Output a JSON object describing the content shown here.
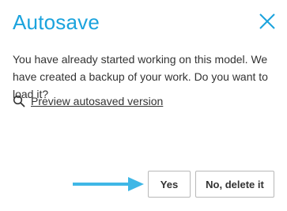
{
  "dialog": {
    "title": "Autosave",
    "message": "You have already started working on this model. We have created a backup of your work. Do you want to load it?",
    "preview_link": "Preview autosaved version",
    "yes_label": "Yes",
    "no_label": "No, delete it"
  },
  "icons": {
    "close": "close-icon",
    "search": "search-icon",
    "arrow": "arrow-right-icon"
  },
  "colors": {
    "accent": "#1ba3dd",
    "arrow": "#3fb7e6",
    "text": "#333333",
    "button_border": "#b8b8b8"
  }
}
